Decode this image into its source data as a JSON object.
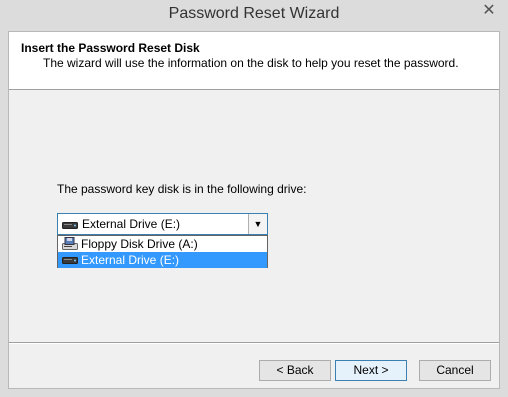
{
  "window": {
    "title": "Password Reset Wizard",
    "close_glyph": "✕"
  },
  "header": {
    "title": "Insert the Password Reset Disk",
    "description": "The wizard will use the information on the disk to help you reset the password."
  },
  "drive": {
    "label": "The password key disk is in the following drive:",
    "selected_value": "External Drive (E:)",
    "arrow_glyph": "▼",
    "options": [
      {
        "label": "Floppy Disk Drive (A:)",
        "icon": "floppy-drive-icon"
      },
      {
        "label": "External Drive (E:)",
        "icon": "external-drive-icon",
        "highlighted": true
      }
    ]
  },
  "buttons": {
    "back": "< Back",
    "next": "Next >",
    "cancel": "Cancel"
  },
  "colors": {
    "highlight": "#3399ff",
    "focus_border": "#3c7fb1"
  }
}
